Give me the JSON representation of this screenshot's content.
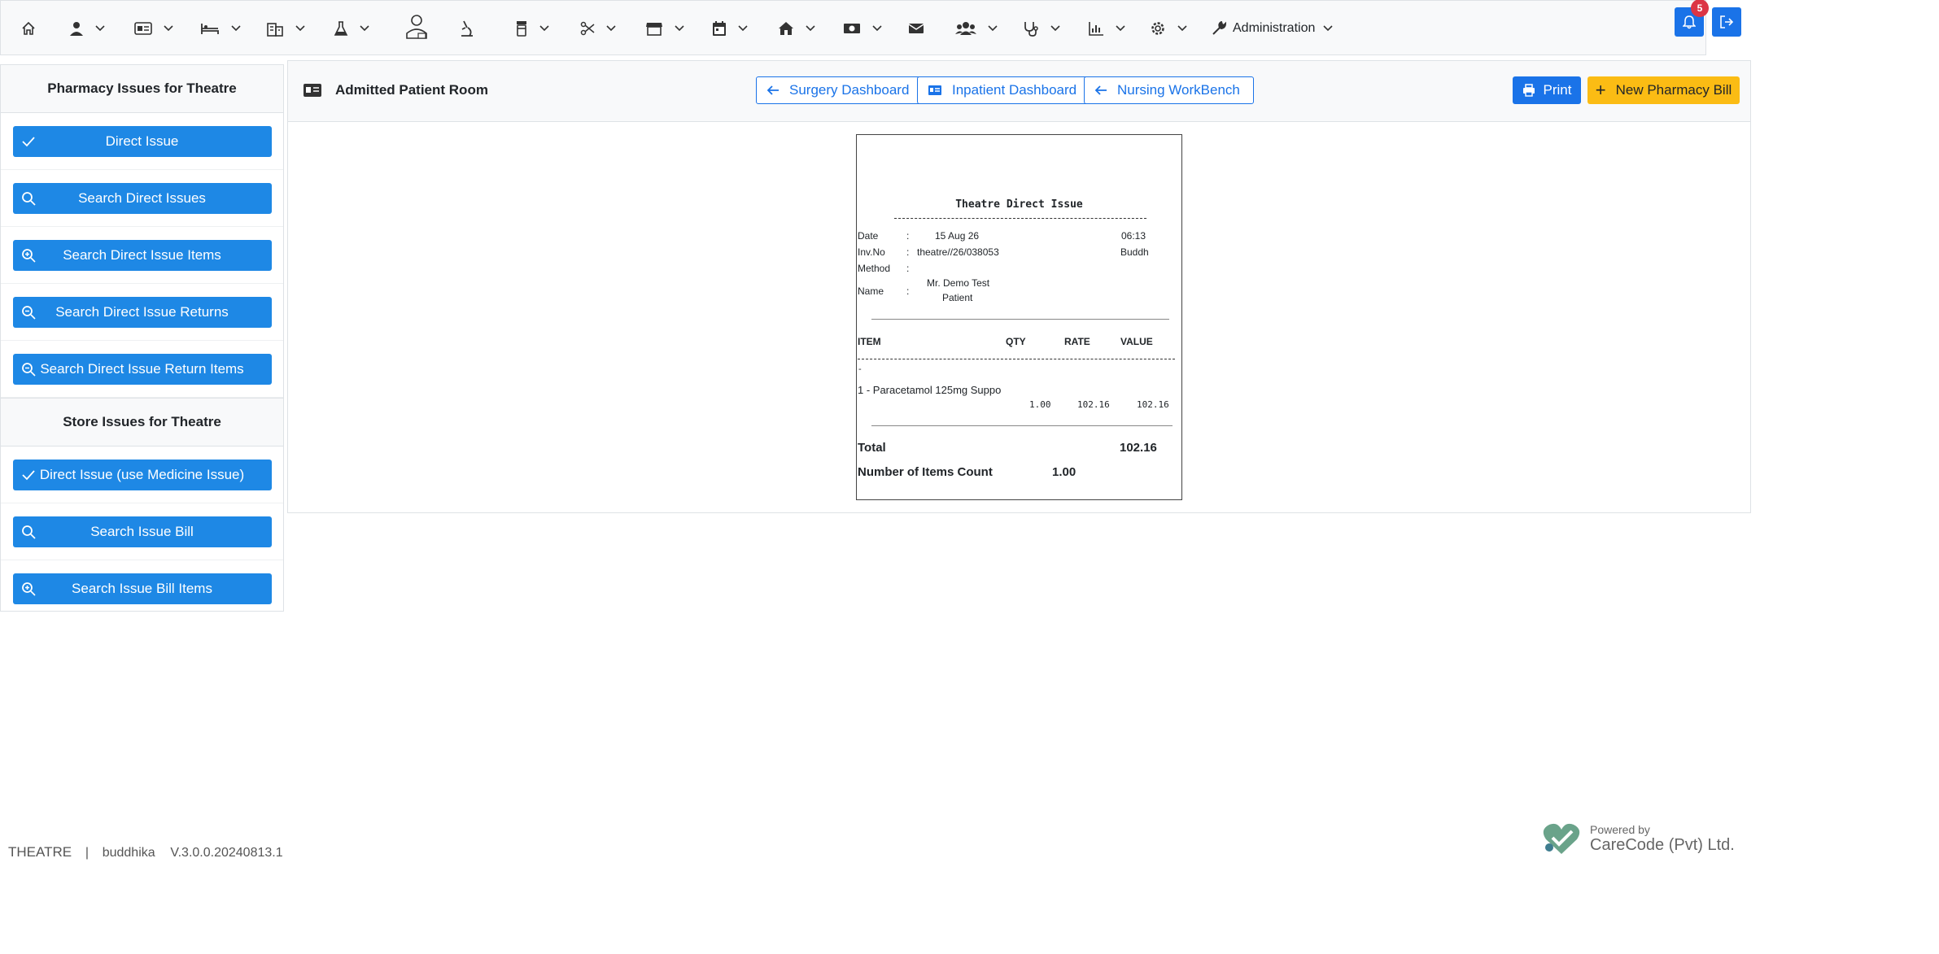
{
  "topnav": {
    "icons": [
      "home-icon",
      "patient-icon",
      "id-card-icon",
      "bed-icon",
      "building-icon",
      "flask-icon",
      "doctor-icon",
      "microscope-icon",
      "pill-bottle-icon",
      "scissors-icon",
      "store-icon",
      "calendar-icon",
      "house-icon",
      "money-icon",
      "envelope-icon",
      "users-icon",
      "stethoscope-icon",
      "bar-chart-icon",
      "gear-icon",
      "wrench-icon"
    ],
    "admin_label": "Administration",
    "notification_count": "5"
  },
  "sidebar": {
    "pharmacy_header": "Pharmacy Issues for Theatre",
    "pharmacy_items": [
      {
        "label": "Direct Issue",
        "icon": "check-icon"
      },
      {
        "label": "Search Direct Issues",
        "icon": "search-icon"
      },
      {
        "label": "Search Direct Issue Items",
        "icon": "zoom-in-icon"
      },
      {
        "label": "Search Direct Issue Returns",
        "icon": "zoom-out-icon"
      },
      {
        "label": "Search Direct Issue Return Items",
        "icon": "zoom-out-icon"
      }
    ],
    "store_header": "Store Issues for Theatre",
    "store_items": [
      {
        "label": "Direct Issue (use Medicine Issue)",
        "icon": "check-icon"
      },
      {
        "label": "Search Issue Bill",
        "icon": "search-icon"
      },
      {
        "label": "Search Issue Bill Items",
        "icon": "zoom-in-icon"
      }
    ]
  },
  "main": {
    "title": "Admitted Patient Room",
    "buttons": {
      "surgery_dashboard": "Surgery Dashboard",
      "inpatient_dashboard": "Inpatient Dashboard",
      "nursing_workbench": "Nursing WorkBench",
      "print": "Print",
      "new_pharmacy_bill": "New Pharmacy Bill"
    }
  },
  "receipt": {
    "title": "Theatre Direct Issue",
    "date_label": "Date",
    "date_value": "15 Aug 26",
    "time_value": "06:13",
    "invno_label": "Inv.No",
    "invno_value": "theatre//26/038053",
    "user_value": "Buddh",
    "method_label": "Method",
    "name_label": "Name",
    "name_value_line1": "Mr. Demo Test",
    "name_value_line2": "Patient",
    "colon": ":",
    "col_item": "ITEM",
    "col_qty": "QTY",
    "col_rate": "RATE",
    "col_value": "VALUE",
    "dash_mark": "-",
    "item_name": "1 - Paracetamol 125mg Suppo",
    "item_qty": "1.00",
    "item_rate": "102.16",
    "item_value": "102.16",
    "total_label": "Total",
    "total_value": "102.16",
    "count_label": "Number of Items Count",
    "count_value": "1.00"
  },
  "footer": {
    "module": "THEATRE",
    "separator": "|",
    "user": "buddhika",
    "version": "V.3.0.0.20240813.1",
    "powered_by": "Powered by",
    "company": "CareCode (Pvt) Ltd."
  },
  "colors": {
    "primary": "#1a73e8",
    "sidebar_button": "#1e88e5",
    "warning": "#fbbc14",
    "badge": "#dc3545"
  }
}
